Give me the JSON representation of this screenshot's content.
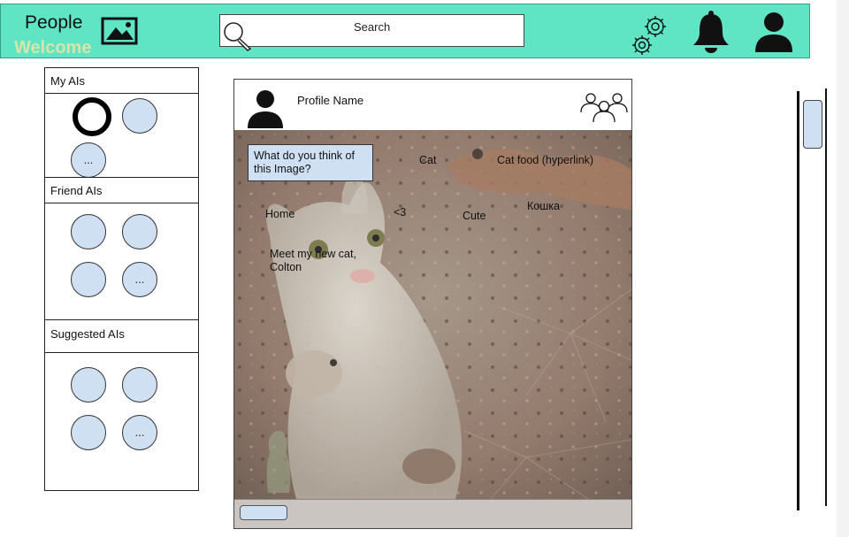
{
  "header": {
    "app_title": "People",
    "welcome_text": "Welcome",
    "search_label": "Search",
    "icons": [
      "image-logo-icon",
      "search-icon",
      "gear-icon",
      "bell-icon",
      "user-icon"
    ]
  },
  "sidebar": {
    "sections": [
      {
        "label": "My AIs",
        "items": [
          "",
          "",
          "..."
        ]
      },
      {
        "label": "Friend AIs",
        "items": [
          "",
          "",
          "",
          "..."
        ]
      },
      {
        "label": "Suggested AIs",
        "items": [
          "",
          "",
          "",
          "..."
        ]
      }
    ]
  },
  "post": {
    "profile_name": "Profile Name",
    "caption": "What do you think of this  Image?",
    "tags": {
      "cat": "Cat",
      "cat_food": "Cat food (hyperlink)",
      "koshka": "Кошка",
      "home": "Home",
      "heart": "<3",
      "cute": "Cute",
      "meet": "Meet my new cat,\nColton"
    }
  },
  "colors": {
    "header_bg": "#5fe5c3",
    "bubble_fill": "#cfe0f3",
    "welcome_text": "#f5e6a6"
  }
}
